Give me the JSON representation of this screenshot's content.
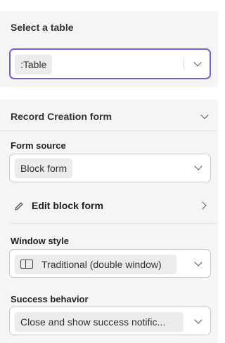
{
  "table_section": {
    "title": "Select a table",
    "selected_value": ":Table"
  },
  "record_section": {
    "title": "Record Creation form",
    "form_source": {
      "label": "Form source",
      "value": "Block form"
    },
    "edit_block_form": {
      "label": "Edit block form"
    },
    "window_style": {
      "label": "Window style",
      "value": "Traditional (double window)",
      "icon": "window-icon"
    },
    "success_behavior": {
      "label": "Success behavior",
      "value": "Close and show success notific..."
    }
  },
  "colors": {
    "focus_border": "#6c63d9",
    "section_background": "#f5f5f5"
  }
}
